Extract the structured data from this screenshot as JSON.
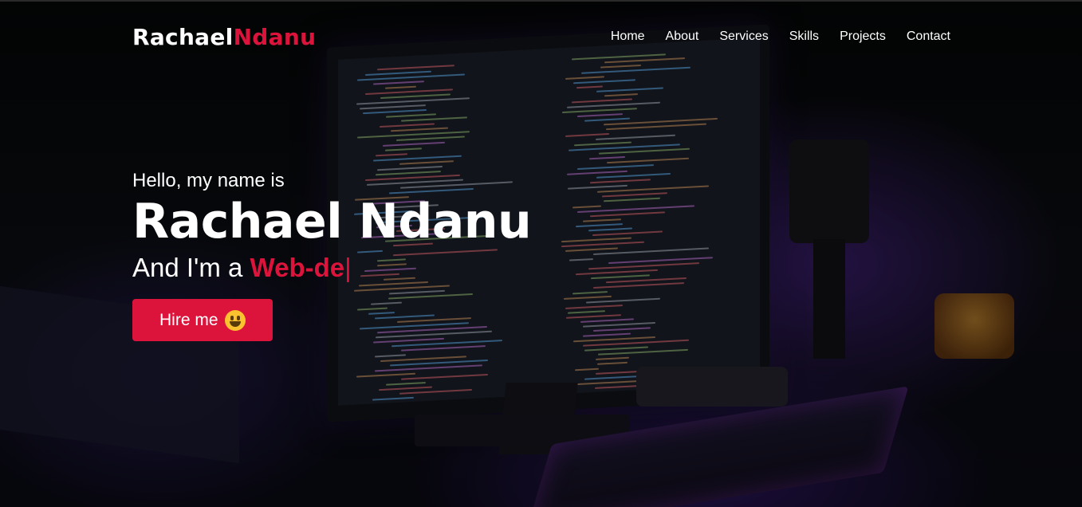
{
  "brand": {
    "first": "Rachael",
    "last": "Ndanu"
  },
  "nav": {
    "items": [
      "Home",
      "About",
      "Services",
      "Skills",
      "Projects",
      "Contact"
    ]
  },
  "hero": {
    "greeting": "Hello, my name is",
    "name": "Rachael Ndanu",
    "role_prefix": "And I'm a ",
    "role_typed": "Web-de",
    "cursor": "|",
    "cta_label": "Hire me",
    "cta_icon": "smiley-emoji-icon"
  },
  "colors": {
    "accent": "#dc143c",
    "text": "#ffffff"
  }
}
